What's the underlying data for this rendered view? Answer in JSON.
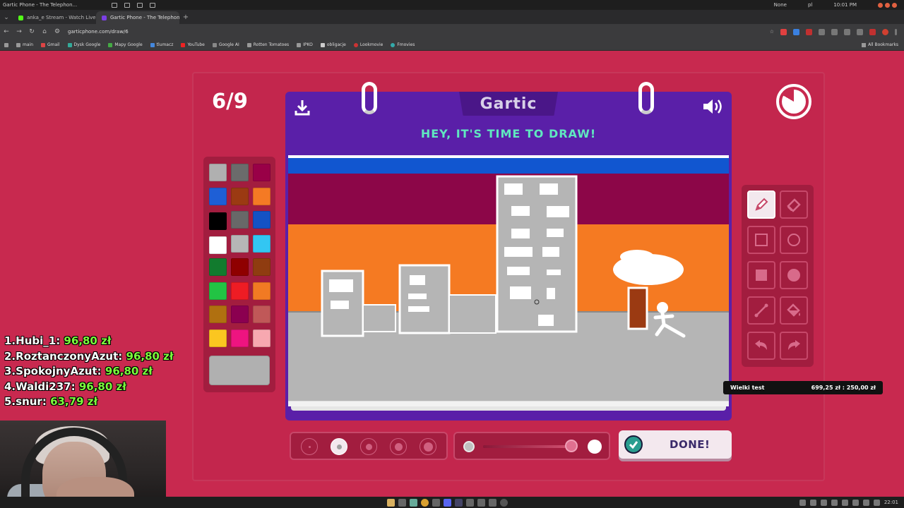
{
  "os_bar": {
    "window_title": "Gartic Phone - The Telephon...",
    "profile": "None",
    "keyboard": "pl",
    "clock": "10:01 PM"
  },
  "tabs": [
    {
      "label": "anka_e Stream - Watch Live...",
      "favicon_color": "#53fc18",
      "active": false
    },
    {
      "label": "Gartic Phone - The Telephon...",
      "favicon_color": "#7b3fe4",
      "active": true
    }
  ],
  "address": {
    "url": "garticphone.com/draw/6"
  },
  "bookmarks": [
    {
      "label": "main"
    },
    {
      "label": "Gmail"
    },
    {
      "label": "Dysk Google"
    },
    {
      "label": "Mapy Google"
    },
    {
      "label": "tlumacz"
    },
    {
      "label": "YouTube"
    },
    {
      "label": "Google AI"
    },
    {
      "label": "Rotten Tomatoes"
    },
    {
      "label": "IPKO"
    },
    {
      "label": "obligacje"
    },
    {
      "label": "Lookmovie"
    },
    {
      "label": "Fmovies"
    }
  ],
  "all_bookmarks": "All Bookmarks",
  "game": {
    "round": "6/9",
    "logo": "Gartic",
    "instruction": "HEY, IT'S TIME TO DRAW!",
    "done_label": "DONE!",
    "opacity_level": 0.95,
    "selected_size_index": 1,
    "selected_tool": "pen"
  },
  "palette": [
    "#b0b0b0",
    "#6b6b6b",
    "#990047",
    "#1e5fd6",
    "#9b3a12",
    "#f47a24",
    "#000000",
    "#686868",
    "#1452c4",
    "#ffffff",
    "#b6b6b6",
    "#33c6f2",
    "#127b2e",
    "#8f0000",
    "#8f3c10",
    "#22c444",
    "#ee1c24",
    "#f17a23",
    "#b07010",
    "#8b0050",
    "#c05858",
    "#fbc620",
    "#ee1480",
    "#f7a8b0"
  ],
  "current_color": "#b0b0b0",
  "tools": [
    {
      "name": "pen-tool",
      "icon": "pencil-icon"
    },
    {
      "name": "eraser-tool",
      "icon": "eraser-icon"
    },
    {
      "name": "rect-outline-tool",
      "icon": "square-outline-icon"
    },
    {
      "name": "ellipse-outline-tool",
      "icon": "circle-outline-icon"
    },
    {
      "name": "rect-fill-tool",
      "icon": "square-filled-icon"
    },
    {
      "name": "ellipse-fill-tool",
      "icon": "circle-filled-icon"
    },
    {
      "name": "line-tool",
      "icon": "line-icon"
    },
    {
      "name": "fill-tool",
      "icon": "paint-bucket-icon"
    },
    {
      "name": "undo-tool",
      "icon": "undo-icon"
    },
    {
      "name": "redo-tool",
      "icon": "redo-icon"
    }
  ],
  "leaderboard": [
    {
      "rank": "1.",
      "name": "Hubi_1:",
      "amount": "96,80 zł"
    },
    {
      "rank": "2.",
      "name": "RoztanczonyAzut:",
      "amount": "96,80 zł"
    },
    {
      "rank": "3.",
      "name": "SpokojnyAzut:",
      "amount": "96,80 zł"
    },
    {
      "rank": "4.",
      "name": "Waldi237:",
      "amount": "96,80 zł"
    },
    {
      "rank": "5.",
      "name": "snur:",
      "amount": "63,79 zł"
    }
  ],
  "goal": {
    "label": "Wielki test",
    "value": "699,25 zł : 250,00 zł"
  },
  "taskbar": {
    "clock": "22:01"
  }
}
